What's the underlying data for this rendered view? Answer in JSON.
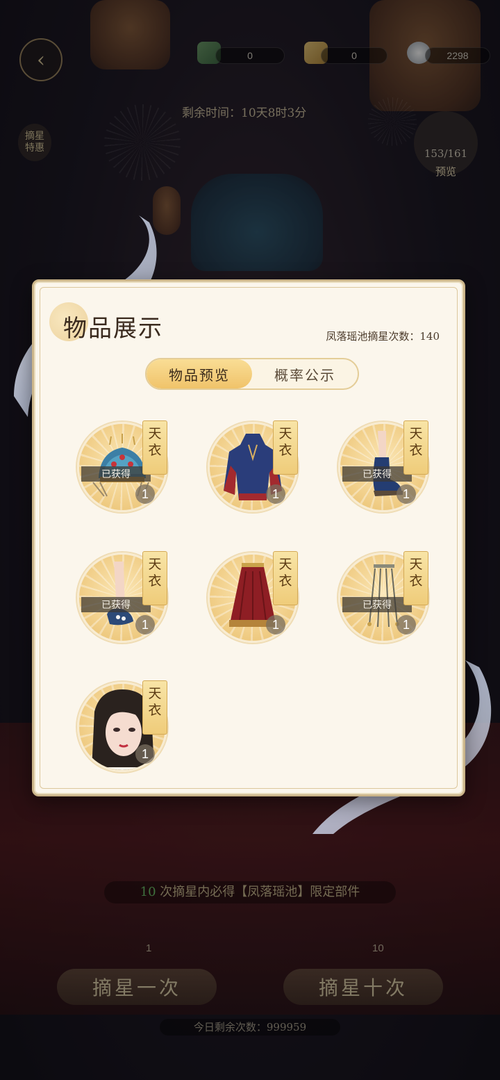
{
  "topbar": {
    "currency1_value": "0",
    "currency2_value": "0",
    "currency3_value": "2298",
    "timer_text": "剩余时间：10天8时3分"
  },
  "side_button": {
    "line1": "摘星",
    "line2": "特惠"
  },
  "progress_badge": {
    "count": "153/161",
    "label": "预览"
  },
  "bottom": {
    "guarantee_num": "10",
    "guarantee_text": " 次摘星内必得【凤落瑶池】限定部件",
    "cost_single": "1",
    "cost_ten": "10",
    "draw_once_label": "摘星一次",
    "draw_ten_label": "摘星十次",
    "remaining_today": "今日剩余次数：999959"
  },
  "panel": {
    "title": "物品展示",
    "pull_count": "凤落瑶池摘星次数：140",
    "tabs": [
      {
        "label": "物品预览",
        "active": true
      },
      {
        "label": "概率公示",
        "active": false
      }
    ],
    "items": [
      {
        "name": "phoenix-crown",
        "tier_line1": "天",
        "tier_line2": "衣",
        "obtained": "已获得",
        "qty": "1"
      },
      {
        "name": "blue-red-robe",
        "tier_line1": "天",
        "tier_line2": "衣",
        "obtained": "",
        "qty": "1"
      },
      {
        "name": "blue-boots",
        "tier_line1": "天",
        "tier_line2": "衣",
        "obtained": "已获得",
        "qty": "1"
      },
      {
        "name": "embroidered-shoes",
        "tier_line1": "天",
        "tier_line2": "衣",
        "obtained": "已获得",
        "qty": "1"
      },
      {
        "name": "red-skirt",
        "tier_line1": "天",
        "tier_line2": "衣",
        "obtained": "",
        "qty": "1"
      },
      {
        "name": "tassel-ornament",
        "tier_line1": "天",
        "tier_line2": "衣",
        "obtained": "已获得",
        "qty": "1"
      },
      {
        "name": "makeup-face",
        "tier_line1": "天",
        "tier_line2": "衣",
        "obtained": "",
        "qty": "1"
      }
    ]
  }
}
